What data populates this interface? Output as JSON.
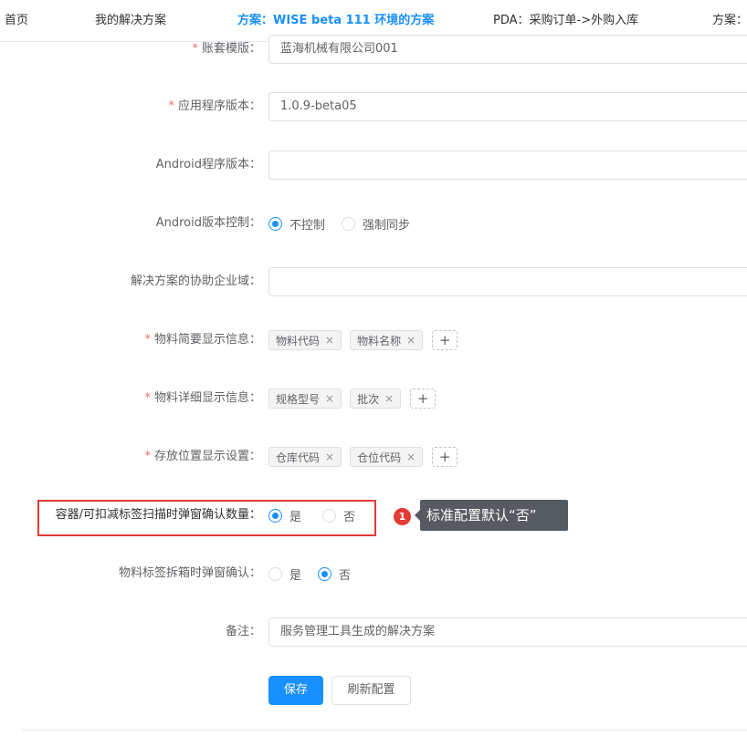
{
  "tabs": [
    {
      "label": "首页"
    },
    {
      "label": "我的解决方案"
    },
    {
      "label": "方案：WISE beta 111 环境的方案",
      "active": true
    },
    {
      "label": "PDA：采购订单->外购入库"
    },
    {
      "label": "方案："
    }
  ],
  "form": {
    "account_template": {
      "label": "账套模版：",
      "required": true,
      "value": "蓝海机械有限公司001"
    },
    "app_version": {
      "label": "应用程序版本：",
      "required": true,
      "value": "1.0.9-beta05"
    },
    "android_version": {
      "label": "Android程序版本：",
      "required": false,
      "value": ""
    },
    "android_control": {
      "label": "Android版本控制：",
      "options": [
        {
          "label": "不控制",
          "checked": true
        },
        {
          "label": "强制同步",
          "checked": false
        }
      ]
    },
    "coop_domain": {
      "label": "解决方案的协助企业域：",
      "value": ""
    },
    "material_brief": {
      "label": "物料简要显示信息：",
      "required": true,
      "tags": [
        "物料代码",
        "物料名称"
      ]
    },
    "material_detail": {
      "label": "物料详细显示信息：",
      "required": true,
      "tags": [
        "规格型号",
        "批次"
      ]
    },
    "storage_display": {
      "label": "存放位置显示设置：",
      "required": true,
      "tags": [
        "仓库代码",
        "仓位代码"
      ]
    },
    "container_confirm": {
      "label": "容器/可扣减标签扫描时弹窗确认数量：",
      "options": [
        {
          "label": "是",
          "checked": true
        },
        {
          "label": "否",
          "checked": false
        }
      ]
    },
    "split_confirm": {
      "label": "物料标签拆箱时弹窗确认：",
      "options": [
        {
          "label": "是",
          "checked": false
        },
        {
          "label": "否",
          "checked": true
        }
      ]
    },
    "remark": {
      "label": "备注：",
      "value": "服务管理工具生成的解决方案"
    }
  },
  "annotation": {
    "badge": "1",
    "text": "标准配置默认“否”",
    "color": "#e53935"
  },
  "buttons": {
    "save": "保存",
    "refresh": "刷新配置"
  },
  "icons": {
    "remove": "×",
    "add": "+"
  },
  "colors": {
    "primary": "#1890ff",
    "required": "#f56c6c",
    "highlight": "#e53935"
  }
}
